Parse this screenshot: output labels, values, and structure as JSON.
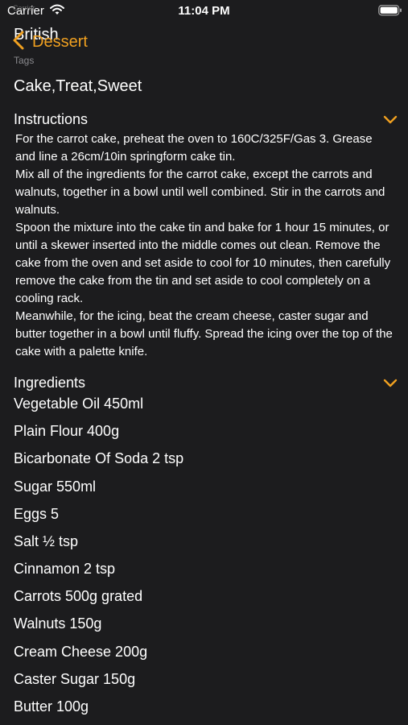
{
  "status_bar": {
    "carrier": "Carrier",
    "time": "11:04 PM"
  },
  "faded_label": "Carrier",
  "navigation": {
    "back_label": "Dessert"
  },
  "meal": {
    "area": "British",
    "tags_label": "Tags",
    "tags": "Cake,Treat,Sweet"
  },
  "instructions": {
    "title": "Instructions",
    "paragraphs": [
      "For the carrot cake, preheat the oven to 160C/325F/Gas 3. Grease and line a 26cm/10in springform cake tin.",
      "Mix all of the ingredients for the carrot cake, except the carrots and walnuts, together in a bowl until well combined. Stir in the carrots and walnuts.",
      "Spoon the mixture into the cake tin and bake for 1 hour 15 minutes, or until a skewer inserted into the middle comes out clean. Remove the cake from the oven and set aside to cool for 10 minutes, then carefully remove the cake from the tin and set aside to cool completely on a cooling rack.",
      "Meanwhile, for the icing, beat the cream cheese, caster sugar and butter together in a bowl until fluffy. Spread the icing over the top of the cake with a palette knife."
    ]
  },
  "ingredients": {
    "title": "Ingredients",
    "items": [
      "Vegetable Oil 450ml",
      "Plain Flour 400g",
      "Bicarbonate Of Soda 2 tsp",
      "Sugar 550ml",
      "Eggs 5",
      "Salt ½ tsp",
      "Cinnamon 2 tsp",
      "Carrots 500g grated",
      "Walnuts 150g",
      "Cream Cheese 200g",
      "Caster Sugar 150g",
      "Butter 100g"
    ]
  },
  "icons": {
    "wifi": "wifi-icon",
    "battery": "battery-icon",
    "back": "chevron-left-icon",
    "expand": "chevron-down-icon"
  },
  "colors": {
    "background": "#1c1c1e",
    "accent": "#f0a020",
    "text": "#ffffff",
    "secondary_text": "#8a8a8e"
  }
}
